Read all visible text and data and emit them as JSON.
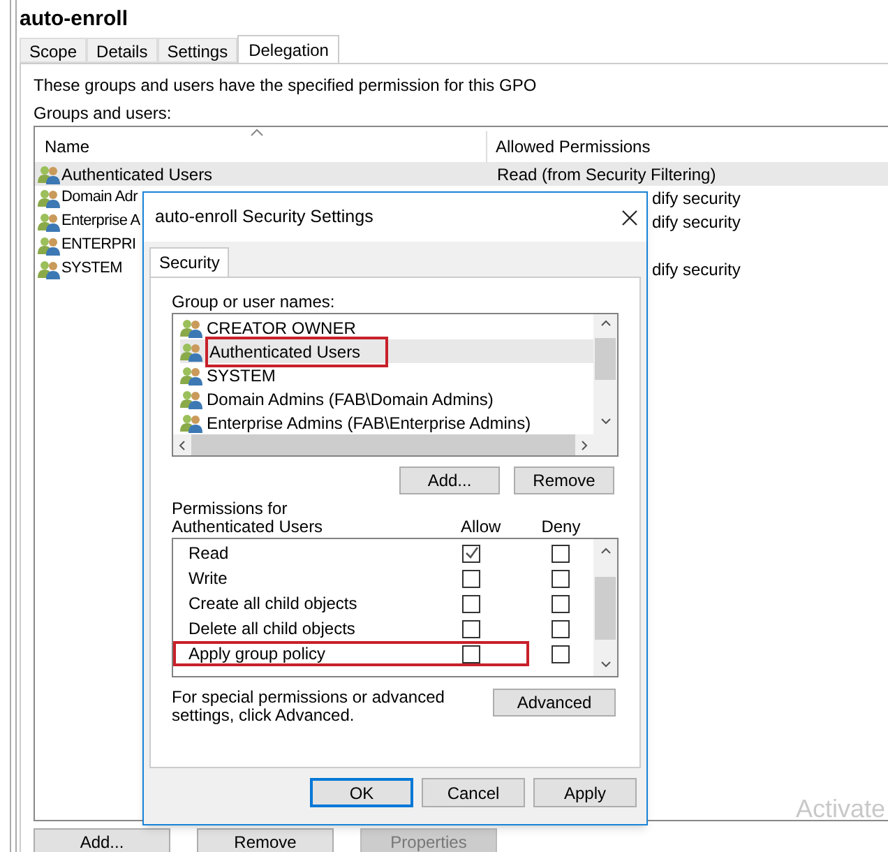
{
  "window": {
    "title": "auto-enroll"
  },
  "tabs": [
    {
      "label": "Scope",
      "selected": false
    },
    {
      "label": "Details",
      "selected": false
    },
    {
      "label": "Settings",
      "selected": false
    },
    {
      "label": "Delegation",
      "selected": true
    }
  ],
  "description": "These groups and users have the specified permission for this GPO",
  "groups_label": "Groups and users:",
  "table": {
    "columns": [
      "Name",
      "Allowed Permissions"
    ],
    "rows": [
      {
        "name": "Authenticated Users",
        "permissions": "Read (from Security Filtering)",
        "selected": true
      },
      {
        "name": "Domain Adr",
        "permissions": "dify security",
        "selected": false
      },
      {
        "name": "Enterprise A",
        "permissions": "dify security",
        "selected": false
      },
      {
        "name": "ENTERPRI",
        "selected": false
      },
      {
        "name": "SYSTEM",
        "permissions": "dify security",
        "selected": false
      }
    ]
  },
  "buttons": [
    {
      "label": "Add...",
      "disabled": false
    },
    {
      "label": "Remove",
      "disabled": false
    },
    {
      "label": "Properties",
      "disabled": true
    }
  ],
  "dialog": {
    "title": "auto-enroll Security Settings",
    "tab": "Security",
    "group_label": "Group or user names:",
    "groups": [
      {
        "name": "CREATOR OWNER",
        "selected": false,
        "highlighted": false
      },
      {
        "name": "Authenticated Users",
        "selected": true,
        "highlighted": true
      },
      {
        "name": "SYSTEM",
        "selected": false,
        "highlighted": false
      },
      {
        "name": "Domain Admins (FAB\\Domain Admins)",
        "selected": false,
        "highlighted": false
      },
      {
        "name": "Enterprise Admins (FAB\\Enterprise Admins)",
        "selected": false,
        "highlighted": false
      }
    ],
    "group_buttons": [
      "Add...",
      "Remove"
    ],
    "permissions_label": "Permissions for Authenticated Users",
    "allow_label": "Allow",
    "deny_label": "Deny",
    "permissions": [
      {
        "name": "Read",
        "allow": true,
        "deny": false,
        "highlighted": false
      },
      {
        "name": "Write",
        "allow": false,
        "deny": false,
        "highlighted": false
      },
      {
        "name": "Create all child objects",
        "allow": false,
        "deny": false,
        "highlighted": false
      },
      {
        "name": "Delete all child objects",
        "allow": false,
        "deny": false,
        "highlighted": false
      },
      {
        "name": "Apply group policy",
        "allow": false,
        "deny": false,
        "highlighted": true
      }
    ],
    "advanced_note": "For special permissions or advanced settings, click Advanced.",
    "advanced_button": "Advanced",
    "buttons": [
      {
        "label": "OK",
        "default": true
      },
      {
        "label": "Cancel",
        "default": false
      },
      {
        "label": "Apply",
        "default": false
      }
    ]
  },
  "activation_notice": "Activate"
}
